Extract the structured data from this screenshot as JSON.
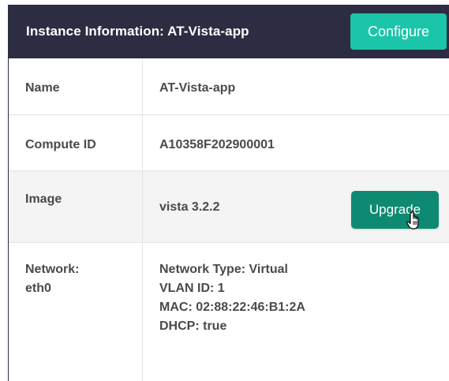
{
  "header": {
    "title": "Instance Information: AT-Vista-app",
    "configure_label": "Configure"
  },
  "rows": [
    {
      "label": "Name",
      "value": "AT-Vista-app"
    },
    {
      "label": "Compute ID",
      "value": "A10358F202900001"
    },
    {
      "label": "Image",
      "value": "vista 3.2.2",
      "action_label": "Upgrade"
    },
    {
      "label": "Network:\neth0",
      "values": [
        "Network Type: Virtual",
        "VLAN ID: 1",
        "MAC: 02:88:22:46:B1:2A",
        "DHCP: true"
      ]
    }
  ],
  "colors": {
    "header_bg": "#2c2d43",
    "configure_bg": "#1bc5a9",
    "upgrade_bg": "#0f8a72",
    "alt_row_bg": "#f4f4f4"
  },
  "icons": [
    "hand-pointer-cursor-icon"
  ]
}
